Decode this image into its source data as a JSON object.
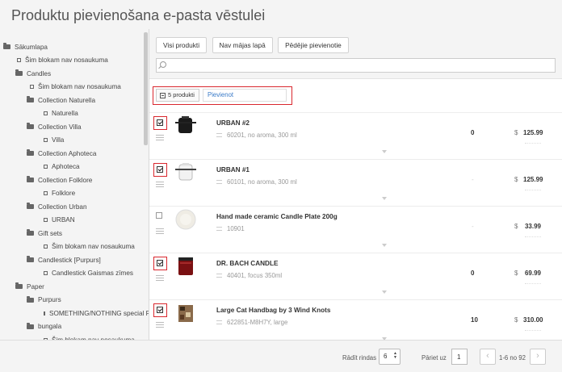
{
  "window": {
    "title": "Produktu pievienošana e-pasta vēstulei"
  },
  "sidebar": {
    "items": [
      {
        "label": "Sākumlapa",
        "kind": "folder",
        "depth": 0
      },
      {
        "label": "Šim blokam nav nosaukuma",
        "kind": "leaf",
        "depth": 1
      },
      {
        "label": "Candles",
        "kind": "folder",
        "depth": 1
      },
      {
        "label": "Šim blokam nav nosaukuma",
        "kind": "leaf",
        "depth": 2
      },
      {
        "label": "Collection Naturella",
        "kind": "folder",
        "depth": 2
      },
      {
        "label": "Naturella",
        "kind": "leaf",
        "depth": 3
      },
      {
        "label": "Collection Villa",
        "kind": "folder",
        "depth": 2
      },
      {
        "label": "Villa",
        "kind": "leaf",
        "depth": 3
      },
      {
        "label": "Collection Aphoteca",
        "kind": "folder",
        "depth": 2
      },
      {
        "label": "Aphoteca",
        "kind": "leaf",
        "depth": 3
      },
      {
        "label": "Collection Folklore",
        "kind": "folder",
        "depth": 2
      },
      {
        "label": "Folklore",
        "kind": "leaf",
        "depth": 3
      },
      {
        "label": "Collection Urban",
        "kind": "folder",
        "depth": 2
      },
      {
        "label": "URBAN",
        "kind": "leaf",
        "depth": 3
      },
      {
        "label": "Gift sets",
        "kind": "folder",
        "depth": 2
      },
      {
        "label": "Šim blokam nav nosaukuma",
        "kind": "leaf",
        "depth": 3
      },
      {
        "label": "Candlestick [Purpurs]",
        "kind": "folder",
        "depth": 2
      },
      {
        "label": "Candlestick Gaismas zīmes",
        "kind": "leaf",
        "depth": 3
      },
      {
        "label": "Paper",
        "kind": "folder",
        "depth": 1
      },
      {
        "label": "Purpurs",
        "kind": "folder",
        "depth": 2
      },
      {
        "label": "SOMETHING/NOTHING special Rec",
        "kind": "leaf",
        "depth": 3
      },
      {
        "label": "bungala",
        "kind": "folder",
        "depth": 2
      },
      {
        "label": "Šim blokam nav nosaukuma",
        "kind": "leaf",
        "depth": 3
      }
    ]
  },
  "toolbar": {
    "tabs": [
      "Visi produkti",
      "Nav mājas lapā",
      "Pēdējie pievienotie"
    ],
    "search_placeholder": ""
  },
  "actions": {
    "selected_count_label": "5 produkti",
    "add_label": "Pievienot"
  },
  "products": [
    {
      "name": "URBAN #2",
      "desc": "60201, no aroma, 300 ml",
      "qty": "0",
      "currency": "$",
      "price": "125.99",
      "checked": true
    },
    {
      "name": "URBAN #1",
      "desc": "60101, no aroma, 300 ml",
      "qty": "-",
      "currency": "$",
      "price": "125.99",
      "checked": true
    },
    {
      "name": "Hand made ceramic Candle Plate 200g",
      "desc": "10901",
      "qty": "-",
      "currency": "$",
      "price": "33.99",
      "checked": false
    },
    {
      "name": "DR. BACH CANDLE",
      "desc": "40401, focus 350ml",
      "qty": "0",
      "currency": "$",
      "price": "69.99",
      "checked": true
    },
    {
      "name": "Large Cat Handbag by 3 Wind Knots",
      "desc": "622851-M8H7Y, large",
      "qty": "10",
      "currency": "$",
      "price": "310.00",
      "checked": true
    }
  ],
  "footer": {
    "rows_label": "Rādīt rindas",
    "rows_value": "6",
    "goto_label": "Pāriet uz",
    "page_value": "1",
    "page_info": "1-6 no 92",
    "prev_icon": "chevron-left-icon",
    "next_icon": "chevron-right-icon"
  },
  "colors": {
    "highlight": "#d9272e",
    "link": "#3a7bc8"
  }
}
